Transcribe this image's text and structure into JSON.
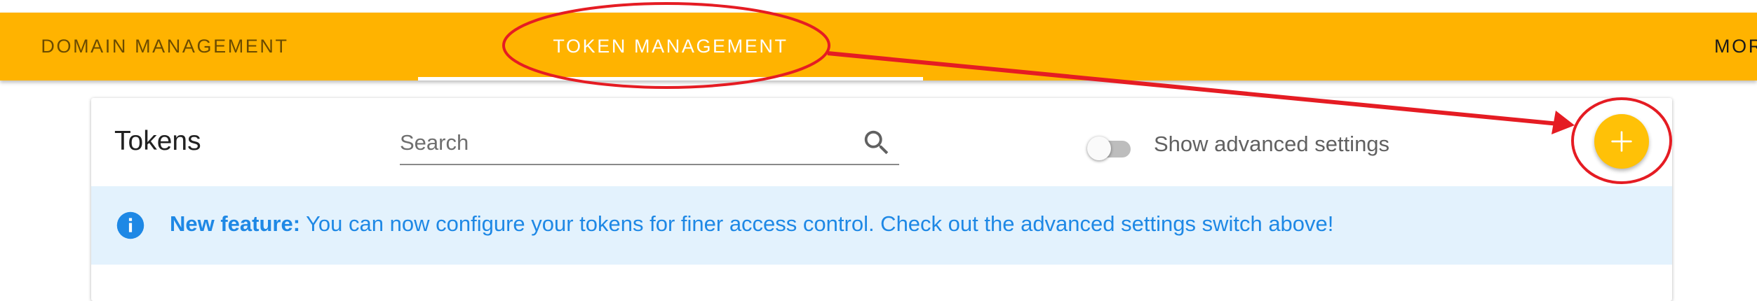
{
  "tabs": [
    {
      "label": "DOMAIN MANAGEMENT"
    },
    {
      "label": "TOKEN MANAGEMENT",
      "active": true
    },
    {
      "label": "MOR"
    }
  ],
  "tokens_card": {
    "title": "Tokens",
    "search": {
      "placeholder": "Search",
      "value": ""
    },
    "advanced_toggle": {
      "label": "Show advanced settings",
      "checked": false
    }
  },
  "info_banner": {
    "strong": "New feature:",
    "message": " You can now configure your tokens for finer access control. Check out the advanced settings switch above!"
  },
  "add_button": {
    "icon": "plus-icon"
  },
  "colors": {
    "tabbar": "#FFB300",
    "fab": "#FFC107",
    "annotation": "#E51C23",
    "info_bg": "#E3F2FD",
    "info_text": "#1E88E5"
  }
}
